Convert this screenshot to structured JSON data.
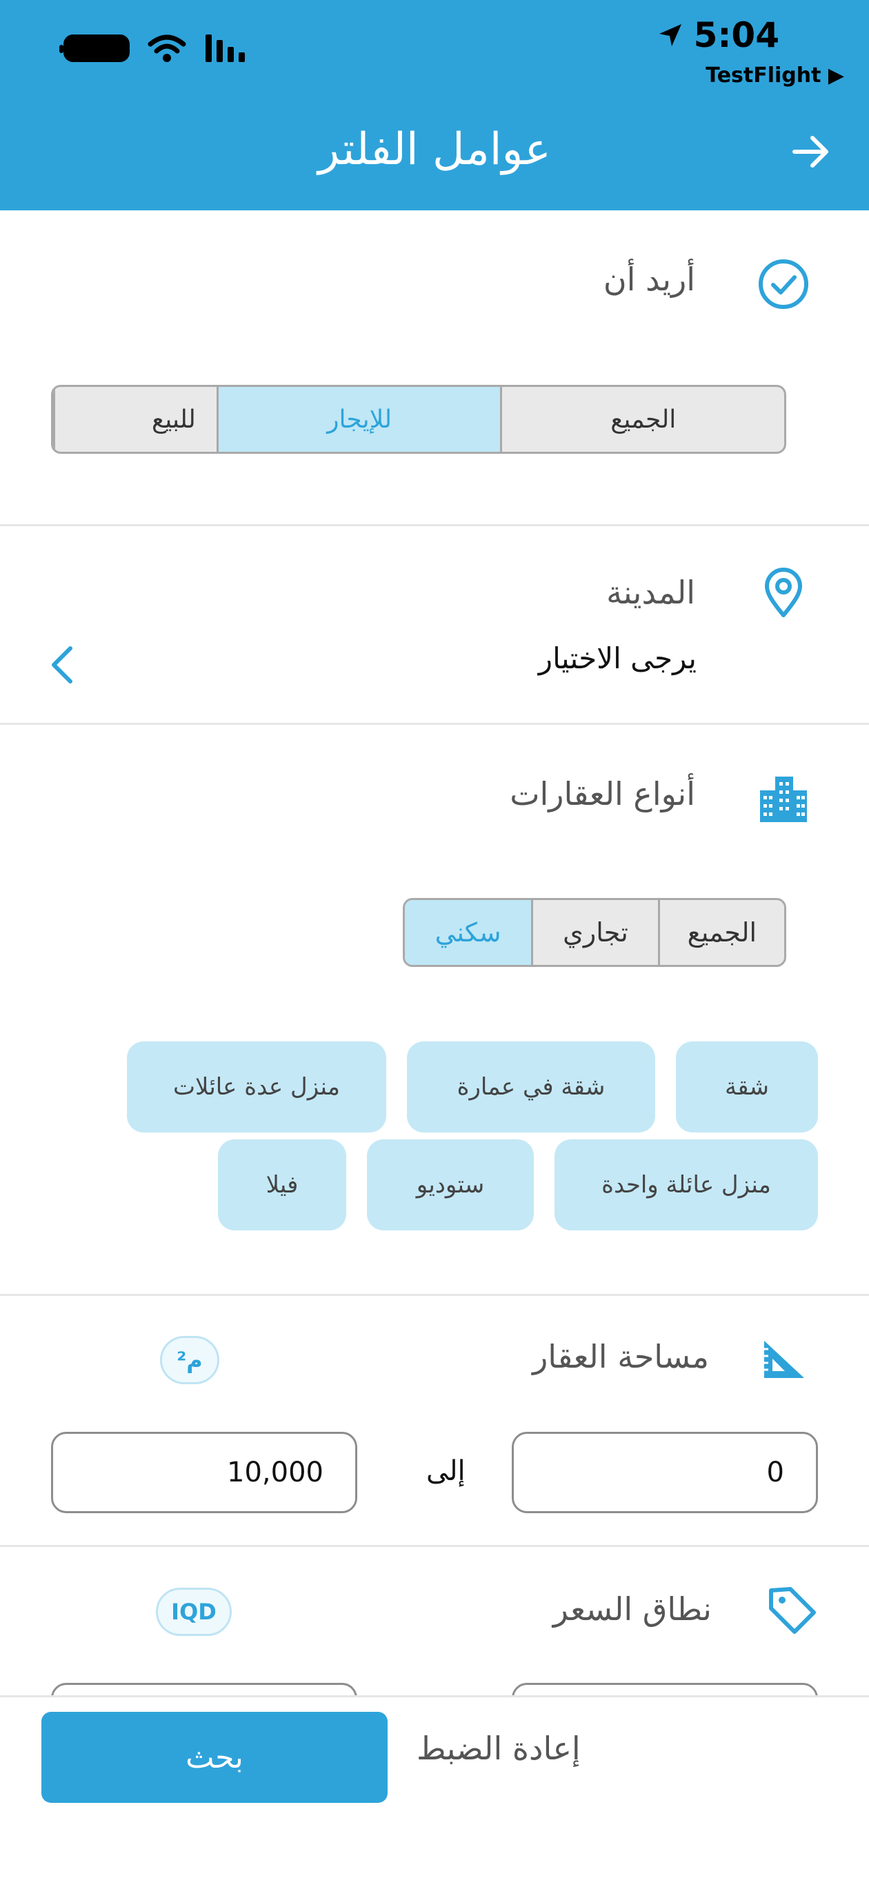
{
  "status_bar": {
    "time": "5:04",
    "testflight": "TestFlight ▶"
  },
  "header": {
    "title": "عوامل الفلتر"
  },
  "intent": {
    "title": "أريد أن",
    "options": [
      "الجميع",
      "للإيجار",
      "للبيع"
    ],
    "selected": "للإيجار"
  },
  "city": {
    "title": "المدينة",
    "value": "يرجى الاختيار"
  },
  "property_types": {
    "title": "أنواع العقارات",
    "categories": [
      "الجميع",
      "تجاري",
      "سكني"
    ],
    "selected_category": "سكني",
    "chips": [
      "شقة",
      "شقة في عمارة",
      "منزل عدة عائلات",
      "منزل عائلة واحدة",
      "ستوديو",
      "فيلا"
    ]
  },
  "area": {
    "title": "مساحة العقار",
    "unit": "م²",
    "min": "0",
    "to_label": "إلى",
    "max": "10,000"
  },
  "price": {
    "title": "نطاق السعر",
    "unit": "IQD"
  },
  "footer": {
    "search_label": "بحث",
    "reset_label": "إعادة الضبط"
  },
  "colors": {
    "primary": "#2ea3da",
    "chip": "#c4e8f6",
    "segment_active": "#bfe7f6"
  }
}
